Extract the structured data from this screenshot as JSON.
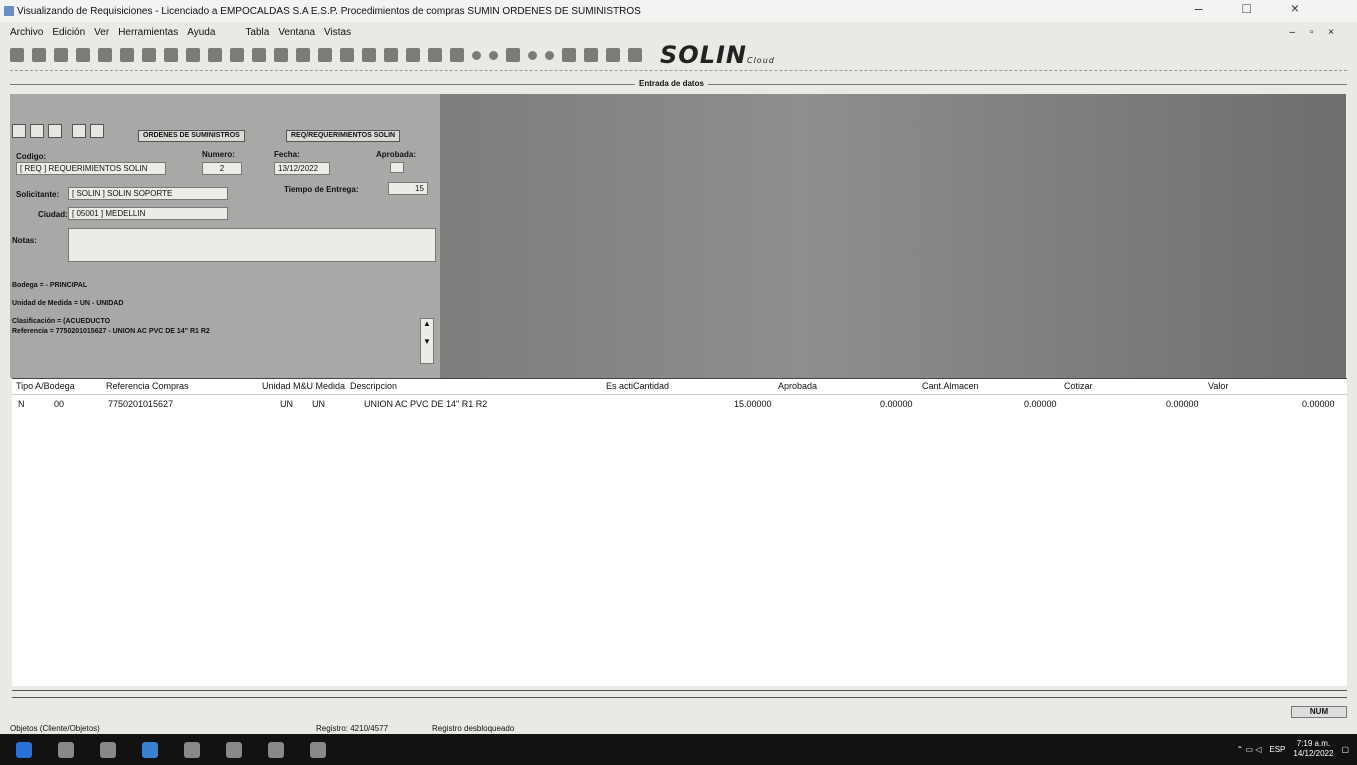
{
  "window": {
    "title": "Visualizando de Requisiciones - Licenciado a EMPOCALDAS S.A E.S.P. Procedimientos de compras SUMIN ORDENES DE SUMINISTROS",
    "controls": "– □ ×"
  },
  "menu": {
    "items": [
      "Archivo",
      "Edición",
      "Ver",
      "Herramientas",
      "Ayuda",
      "Tabla",
      "Ventana",
      "Vistas"
    ],
    "mdi_controls": "– ▫ ×"
  },
  "toolbar": {
    "logo": "SOLIN",
    "logo_sub": "Cloud"
  },
  "caption": "Entrada de datos",
  "form": {
    "tab1": "ORDENES DE SUMINISTROS",
    "tab2": "REQ/REQUERIMIENTOS SOLIN",
    "codigo_label": "Codigo:",
    "codigo_value": "[ REQ ] REQUERIMIENTOS SOLIN",
    "numero_label": "Numero:",
    "numero_value": "2",
    "fecha_label": "Fecha:",
    "fecha_value": "13/12/2022",
    "aprobada_label": "Aprobada:",
    "solicitante_label": "Solicitante:",
    "solicitante_value": "[ SOLIN ] SOLIN SOPORTE",
    "tiempo_label": "Tiempo de Entrega:",
    "tiempo_value": "15",
    "ciudad_label": "Ciudad:",
    "ciudad_value": "[ 05001 ] MEDELLIN",
    "notas_label": "Notas:",
    "bodega": "Bodega = - PRINCIPAL",
    "unidad": "Unidad de Medida = UN - UNIDAD",
    "clasificacion": "Clasificación = (ACUEDUCTO",
    "referencia": "Referencia = 7750201015627 - UNION AC PVC DE 14\" R1 R2"
  },
  "grid": {
    "headers": [
      "Tipo A/Bodega",
      "Referencia Compras",
      "Unidad M&U Medida",
      "Descripcion",
      "Es actiCantidad",
      "Aprobada",
      "Cant.Almacen",
      "Cotizar",
      "Valor"
    ],
    "row": [
      "N",
      "00",
      "7750201015627",
      "UN",
      "UN",
      "UNION AC PVC DE 14\" R1 R2",
      "15.00000",
      "0.00000",
      "0.00000",
      "0.00000",
      "0.00000"
    ]
  },
  "status": {
    "objetos": "Objetos (Cliente/Objetos)",
    "registro": "Registro: 4210/4577",
    "bloqueo": "Registro desbloqueado",
    "num": "NUM"
  },
  "taskbar": {
    "lang": "ESP",
    "time": "7:19 a.m.",
    "date": "14/12/2022"
  }
}
